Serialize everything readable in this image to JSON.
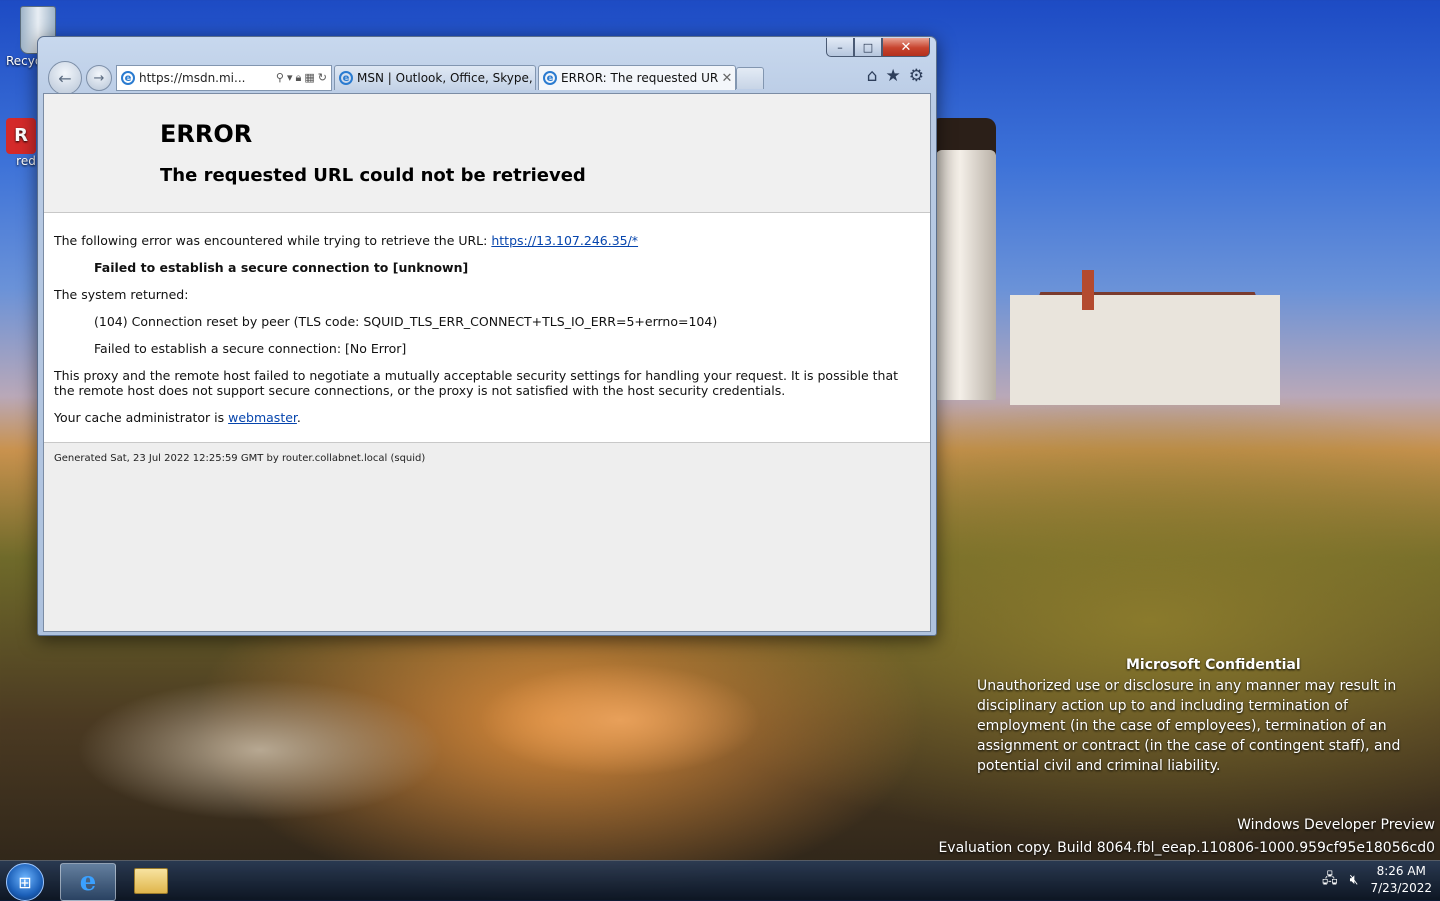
{
  "desktop": {
    "icons": [
      {
        "label": "Recyc"
      },
      {
        "label": "red"
      }
    ],
    "red_icon_letter": "R"
  },
  "browser": {
    "caption": {
      "min": "–",
      "max": "□",
      "close": "✕"
    },
    "address": "https://msdn.mi...",
    "tabs": [
      {
        "label": "MSN | Outlook, Office, Skype, ..."
      },
      {
        "label": "ERROR: The requested URL ...",
        "close": "✕"
      }
    ],
    "toolbar_icons": [
      "home-icon",
      "favorites-icon",
      "tools-icon"
    ]
  },
  "page": {
    "error_title": "ERROR",
    "error_subtitle": "The requested URL could not be retrieved",
    "intro": "The following error was encountered while trying to retrieve the URL: ",
    "url_link": "https://13.107.246.35/*",
    "failed_line": "Failed to establish a secure connection to [unknown]",
    "system_returned": "The system returned:",
    "error_code_line": "(104) Connection reset by peer (TLS code: SQUID_TLS_ERR_CONNECT+TLS_IO_ERR=5+errno=104)",
    "secure_failed": "Failed to establish a secure connection: [No Error]",
    "explanation": "This proxy and the remote host failed to negotiate a mutually acceptable security settings for handling your request. It is possible that the remote host does not support secure connections, or the proxy is not satisfied with the host security credentials.",
    "admin_prefix": "Your cache administrator is ",
    "admin_link": "webmaster",
    "admin_suffix": ".",
    "generated": "Generated Sat, 23 Jul 2022 12:25:59 GMT by router.collabnet.local (squid)"
  },
  "watermark": {
    "title": "Microsoft Confidential",
    "body": "Unauthorized use or disclosure in any manner may result in disciplinary action up to and including termination of employment (in the case of employees), termination of an assignment or contract (in the case of contingent staff), and potential civil and criminal liability.",
    "preview": "Windows Developer Preview",
    "build": "Evaluation copy. Build 8064.fbl_eeap.110806-1000.959cf95e18056cd0"
  },
  "taskbar": {
    "clock_time": "8:26 AM",
    "clock_date": "7/23/2022"
  }
}
